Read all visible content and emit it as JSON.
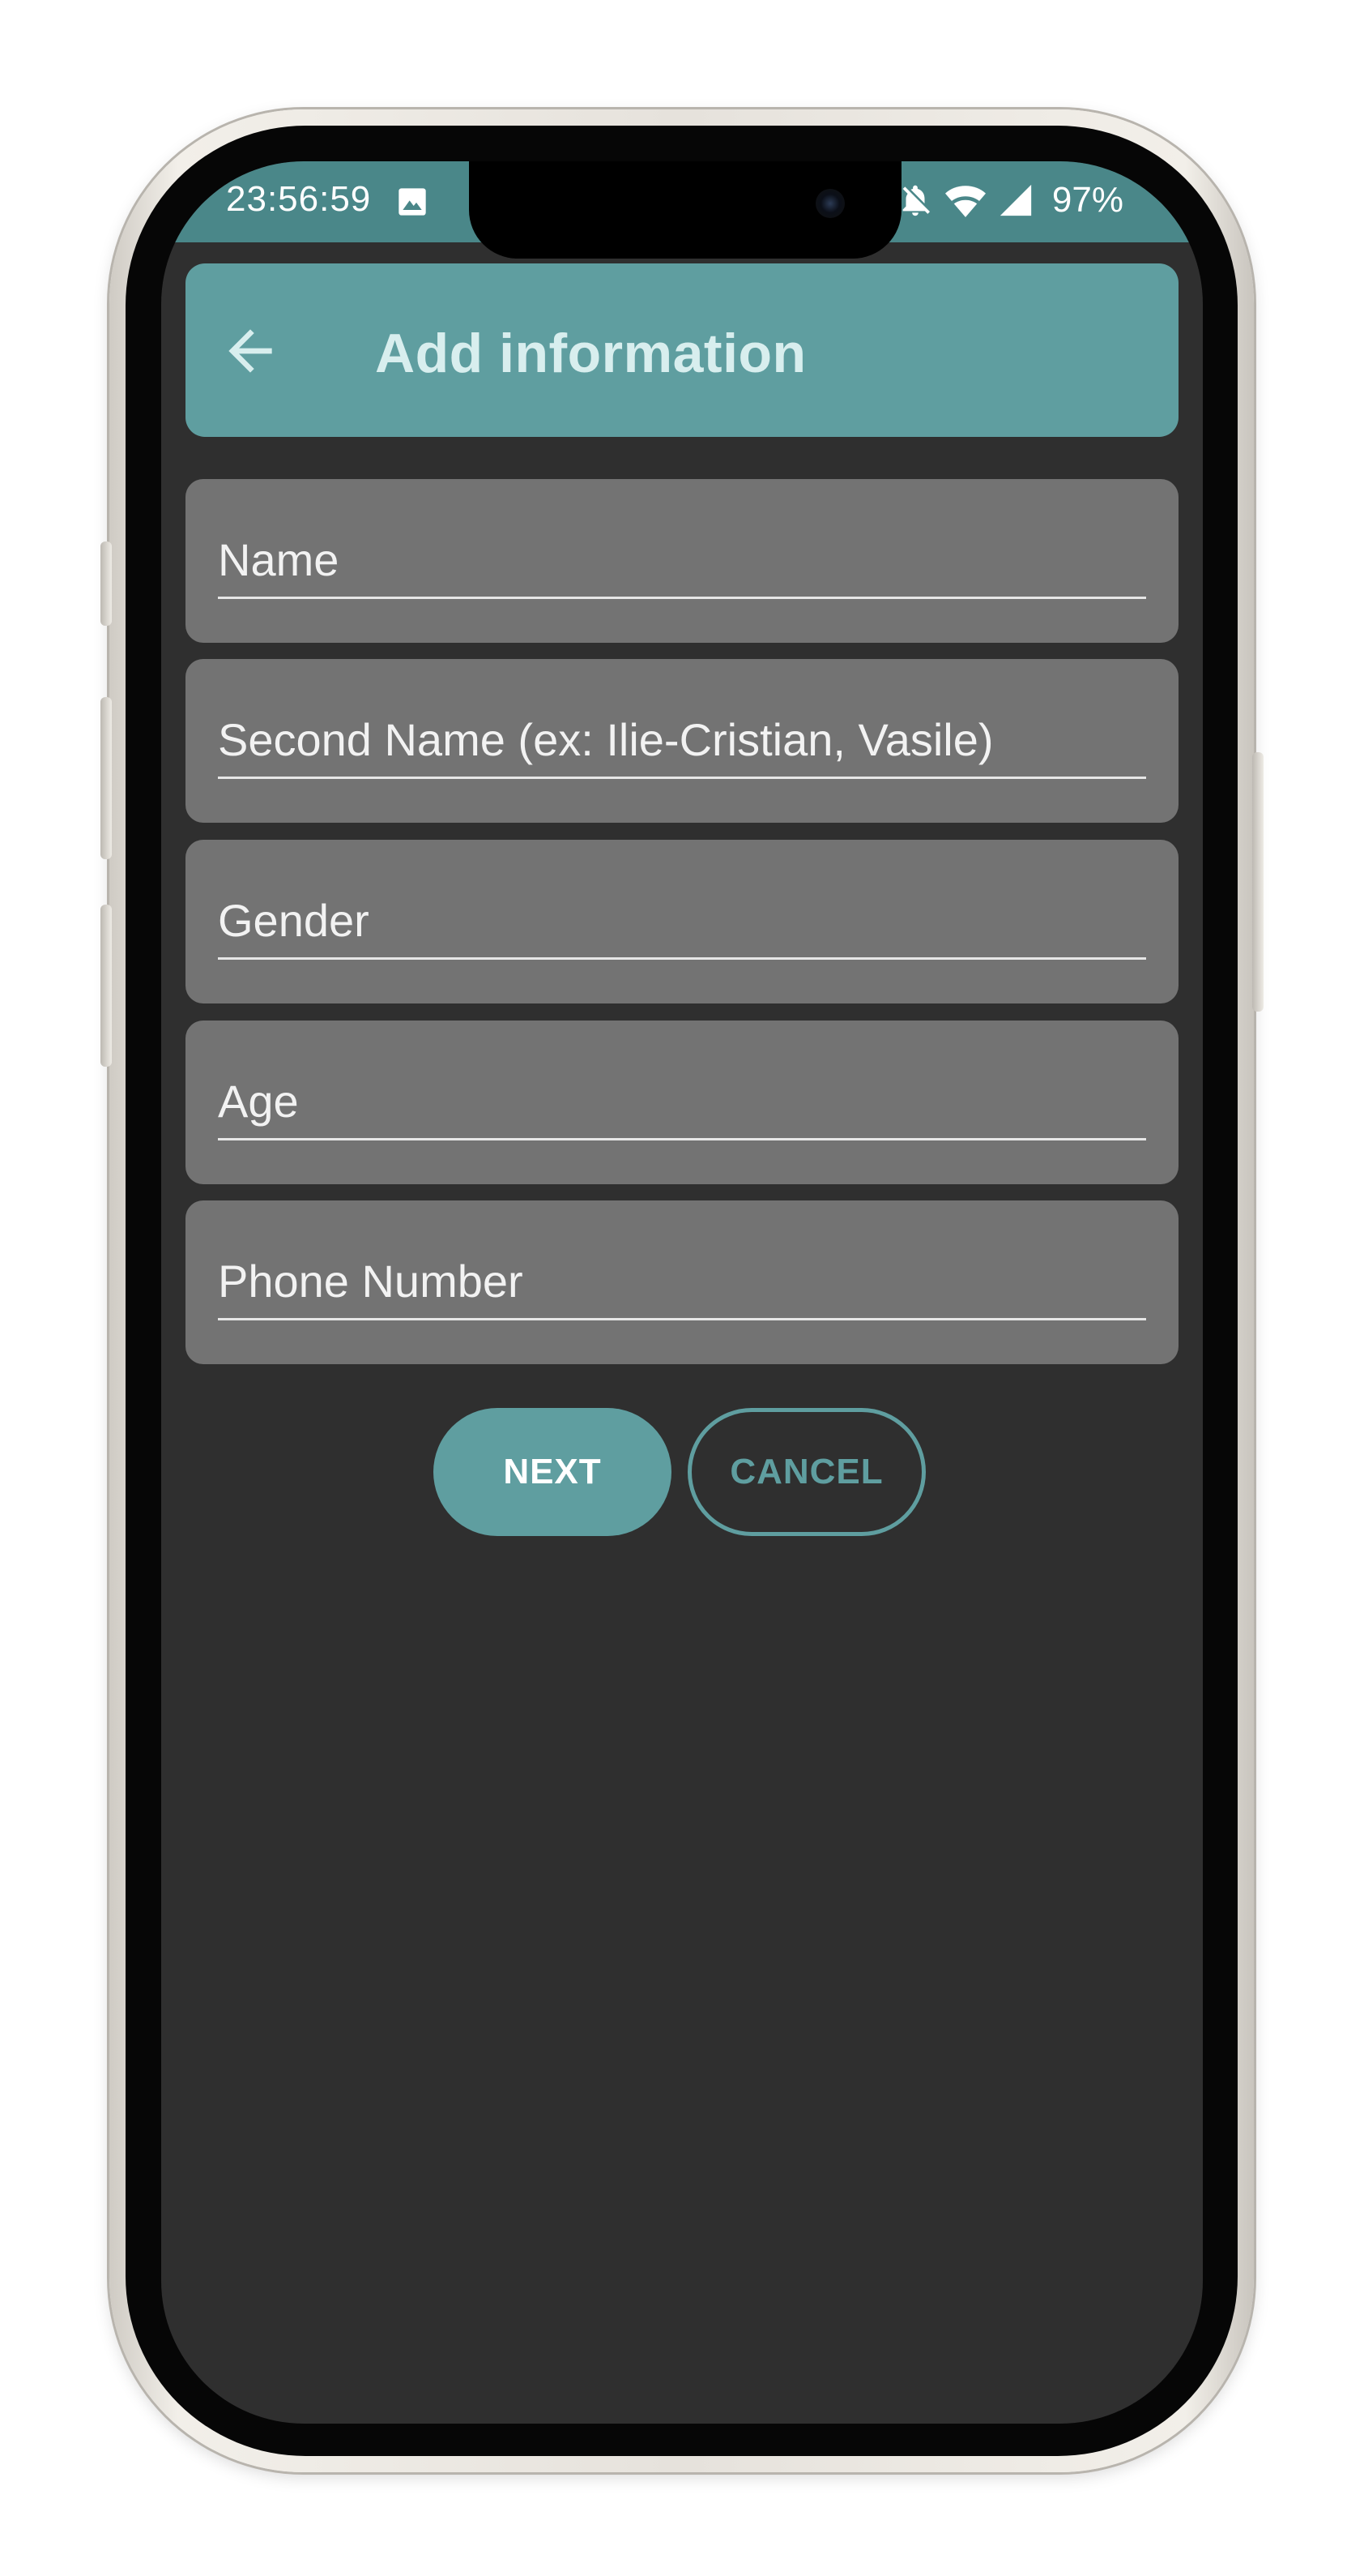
{
  "status_bar": {
    "time": "23:56:59",
    "battery": "97%",
    "icons": [
      "gallery-icon",
      "bell-muted-icon",
      "wifi-icon",
      "signal-icon"
    ]
  },
  "app_bar": {
    "title": "Add information",
    "back_icon": "arrow-left-icon"
  },
  "form": {
    "fields": [
      {
        "placeholder": "Name",
        "value": ""
      },
      {
        "placeholder": "Second Name (ex: Ilie-Cristian, Vasile)",
        "value": ""
      },
      {
        "placeholder": "Gender",
        "value": ""
      },
      {
        "placeholder": "Age",
        "value": ""
      },
      {
        "placeholder": "Phone Number",
        "value": ""
      }
    ]
  },
  "actions": {
    "next_label": "NEXT",
    "cancel_label": "CANCEL"
  },
  "colors": {
    "accent": "#5f9ea0",
    "status_bar": "#4a8789",
    "background": "#2f2f2f",
    "field": "#737373",
    "title_text": "#d8eeee"
  }
}
